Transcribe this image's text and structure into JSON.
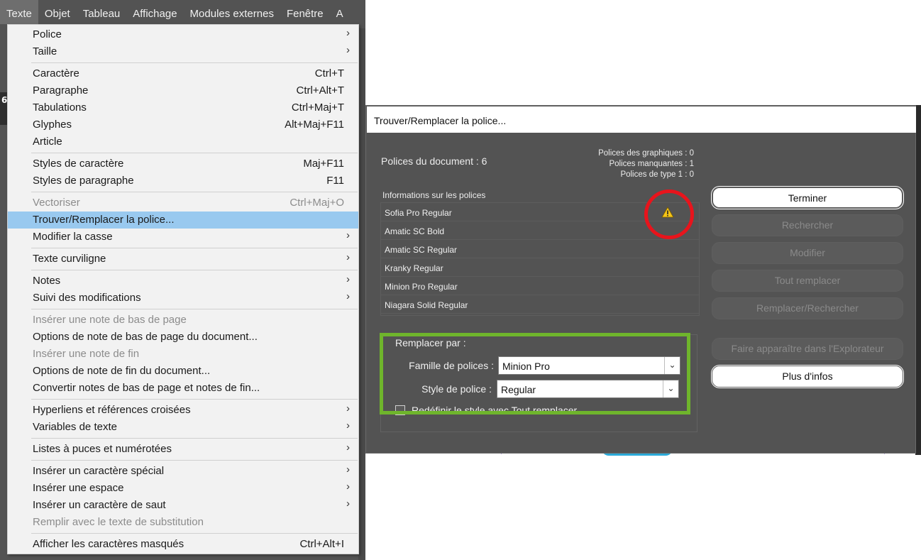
{
  "menubar": {
    "items": [
      "Texte",
      "Objet",
      "Tableau",
      "Affichage",
      "Modules externes",
      "Fenêtre",
      "A"
    ]
  },
  "canvas_partial_text": "6",
  "menu": {
    "police": "Police",
    "taille": "Taille",
    "caractere": "Caractère",
    "caractere_sc": "Ctrl+T",
    "paragraphe": "Paragraphe",
    "paragraphe_sc": "Ctrl+Alt+T",
    "tabulations": "Tabulations",
    "tabulations_sc": "Ctrl+Maj+T",
    "glyphes": "Glyphes",
    "glyphes_sc": "Alt+Maj+F11",
    "article": "Article",
    "styles_caractere": "Styles de caractère",
    "styles_caractere_sc": "Maj+F11",
    "styles_paragraphe": "Styles de paragraphe",
    "styles_paragraphe_sc": "F11",
    "vectoriser": "Vectoriser",
    "vectoriser_sc": "Ctrl+Maj+O",
    "trouver_remplacer": "Trouver/Remplacer la police...",
    "modifier_casse": "Modifier la casse",
    "texte_curviligne": "Texte curviligne",
    "notes": "Notes",
    "suivi": "Suivi des modifications",
    "inserer_note_bas": "Insérer une note de bas de page",
    "options_note_bas": "Options de note de bas de page du document...",
    "inserer_note_fin": "Insérer une note de fin",
    "options_note_fin": "Options de note de fin du document...",
    "convertir_notes": "Convertir notes de bas de page et notes de fin...",
    "hyperliens": "Hyperliens et références croisées",
    "variables": "Variables de texte",
    "listes": "Listes à puces et numérotées",
    "car_special": "Insérer un caractère spécial",
    "espace": "Insérer une espace",
    "car_saut": "Insérer un caractère de saut",
    "remplir": "Remplir avec le texte de substitution",
    "afficher_masques": "Afficher les caractères masqués",
    "afficher_masques_sc": "Ctrl+Alt+I"
  },
  "dialog": {
    "title": "Trouver/Remplacer la police...",
    "doc_fonts": "Polices du document : 6",
    "stats": [
      "Polices des graphiques : 0",
      "Polices manquantes : 1",
      "Polices de type 1 : 0"
    ],
    "info_label": "Informations sur les polices",
    "fonts": [
      "Sofia Pro Regular",
      "Amatic SC Bold",
      "Amatic SC Regular",
      "Kranky Regular",
      "Minion Pro Regular",
      "Niagara Solid Regular"
    ],
    "buttons": {
      "terminer": "Terminer",
      "rechercher": "Rechercher",
      "modifier": "Modifier",
      "tout_remplacer": "Tout remplacer",
      "remplacer_rechercher": "Remplacer/Rechercher",
      "explorateur": "Faire apparaître dans l'Explorateur",
      "plus_infos": "Plus d'infos"
    },
    "replace": {
      "title": "Remplacer par :",
      "famille_label": "Famille de polices :",
      "famille_value": "Minion Pro",
      "style_label": "Style de police :",
      "style_value": "Regular",
      "checkbox_label": "Redéfinir le style avec Tout remplacer"
    }
  },
  "colors": {
    "highlight": "#99c9ef",
    "warning": "#f5c518",
    "annotation_circle": "#e8141c",
    "annotation_box": "#6fb52c"
  }
}
